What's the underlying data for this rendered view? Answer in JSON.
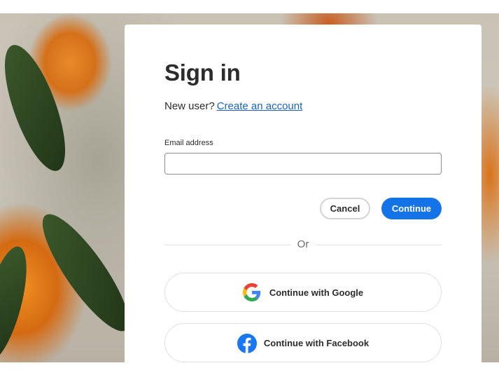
{
  "signin": {
    "title": "Sign in",
    "new_user_text": "New user?",
    "create_account_link": "Create an account",
    "email_label": "Email address",
    "email_value": "",
    "cancel_label": "Cancel",
    "continue_label": "Continue",
    "divider_text": "Or",
    "google_label": "Continue with Google",
    "facebook_label": "Continue with Facebook"
  },
  "colors": {
    "primary_button": "#1473e6",
    "link": "#1b62c8",
    "facebook_blue": "#1877f2"
  },
  "icons": {
    "google": "google-icon",
    "facebook": "facebook-icon"
  }
}
